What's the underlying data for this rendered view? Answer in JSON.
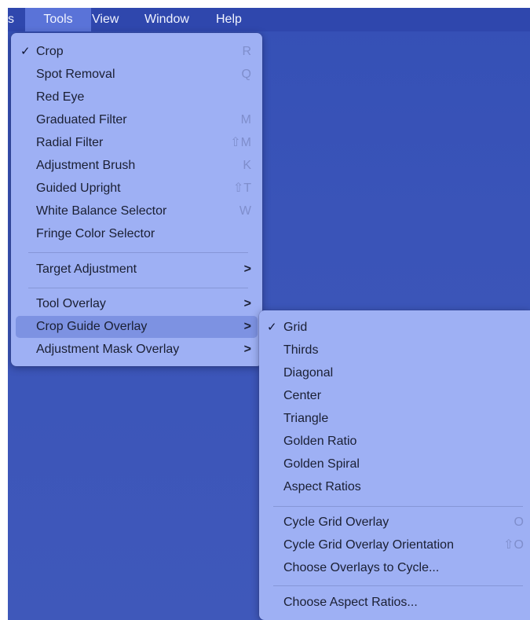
{
  "menubar": {
    "items": [
      {
        "label": "s"
      },
      {
        "label": "Tools"
      },
      {
        "label": "View"
      },
      {
        "label": "Window"
      },
      {
        "label": "Help"
      }
    ]
  },
  "tools_menu": {
    "items": [
      {
        "label": "Crop",
        "shortcut": "R",
        "checked": "✓"
      },
      {
        "label": "Spot Removal",
        "shortcut": "Q"
      },
      {
        "label": "Red Eye",
        "shortcut": ""
      },
      {
        "label": "Graduated Filter",
        "shortcut": "M"
      },
      {
        "label": "Radial Filter",
        "shortcut": "⇧M"
      },
      {
        "label": "Adjustment Brush",
        "shortcut": "K"
      },
      {
        "label": "Guided Upright",
        "shortcut": "⇧T"
      },
      {
        "label": "White Balance Selector",
        "shortcut": "W"
      },
      {
        "label": "Fringe Color Selector",
        "shortcut": ""
      },
      {
        "label": "Target Adjustment",
        "submenu": ">"
      },
      {
        "label": "Tool Overlay",
        "submenu": ">"
      },
      {
        "label": "Crop Guide Overlay",
        "submenu": ">"
      },
      {
        "label": "Adjustment Mask Overlay",
        "submenu": ">"
      }
    ]
  },
  "crop_guide_submenu": {
    "items": [
      {
        "label": "Grid",
        "checked": "✓"
      },
      {
        "label": "Thirds"
      },
      {
        "label": "Diagonal"
      },
      {
        "label": "Center"
      },
      {
        "label": "Triangle"
      },
      {
        "label": "Golden Ratio"
      },
      {
        "label": "Golden Spiral"
      },
      {
        "label": "Aspect Ratios"
      },
      {
        "label": "Cycle Grid Overlay",
        "shortcut": "O"
      },
      {
        "label": "Cycle Grid Overlay Orientation",
        "shortcut": "⇧O"
      },
      {
        "label": "Choose Overlays to Cycle..."
      },
      {
        "label": "Choose Aspect Ratios..."
      }
    ]
  },
  "colors": {
    "desktop": "#3a54b8",
    "menu_bg": "#9eb0f4",
    "highlight": "#7d92e2"
  }
}
